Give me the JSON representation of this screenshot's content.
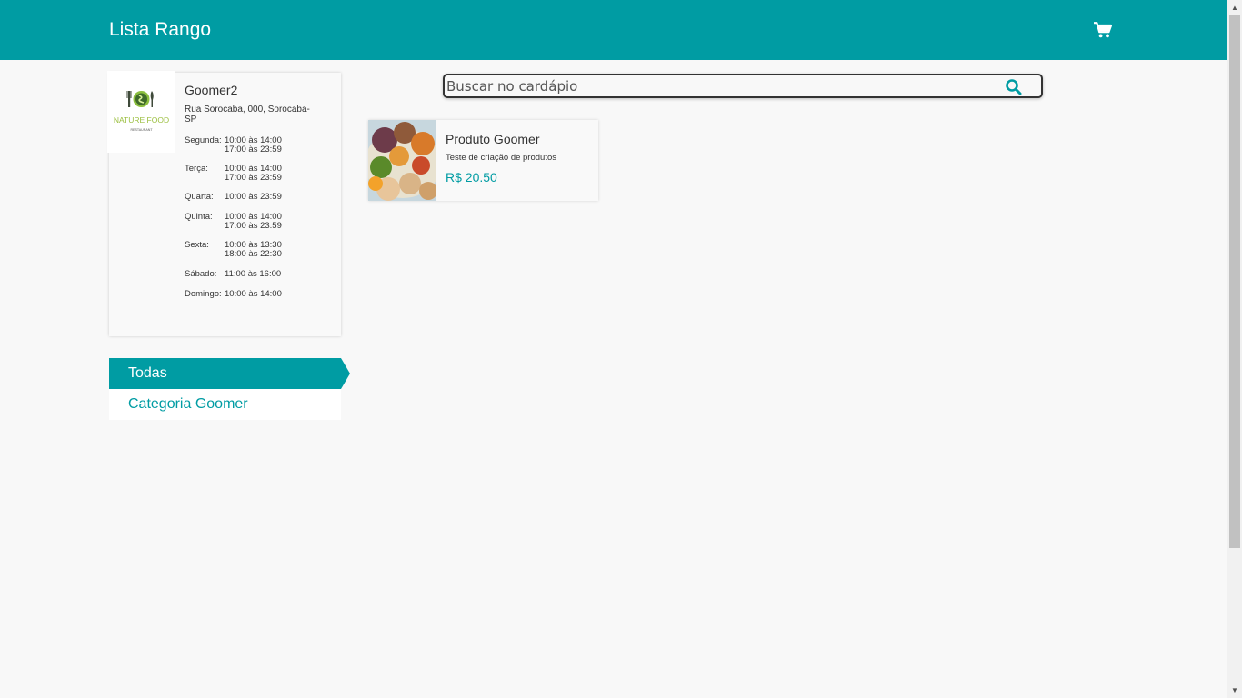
{
  "header": {
    "title": "Lista Rango",
    "cart_icon": "shopping-cart-icon"
  },
  "restaurant": {
    "logo": {
      "name": "NATURE FOOD",
      "sub": "RESTAURANT"
    },
    "name": "Goomer2",
    "address": "Rua Sorocaba, 000, Sorocaba-SP",
    "hours": [
      {
        "day": "Segunda:",
        "times": [
          "10:00 às 14:00",
          "17:00 às 23:59"
        ]
      },
      {
        "day": "Terça:",
        "times": [
          "10:00 às 14:00",
          "17:00 às 23:59"
        ]
      },
      {
        "day": "Quarta:",
        "times": [
          "10:00 às 23:59"
        ]
      },
      {
        "day": "Quinta:",
        "times": [
          "10:00 às 14:00",
          "17:00 às 23:59"
        ]
      },
      {
        "day": "Sexta:",
        "times": [
          "10:00 às 13:30",
          "18:00 às 22:30"
        ]
      },
      {
        "day": "Sábado:",
        "times": [
          "11:00 às 16:00"
        ]
      },
      {
        "day": "Domingo:",
        "times": [
          "10:00 às 14:00"
        ]
      }
    ]
  },
  "categories": [
    {
      "label": "Todas",
      "active": true
    },
    {
      "label": "Categoria Goomer",
      "active": false
    }
  ],
  "search": {
    "placeholder": "Buscar no cardápio",
    "value": "",
    "icon": "search-icon"
  },
  "products": [
    {
      "name": "Produto Goomer",
      "description": "Teste de criação de produtos",
      "price": "R$ 20.50"
    }
  ],
  "colors": {
    "brand": "#009ca3",
    "background": "#f8f8f8"
  }
}
